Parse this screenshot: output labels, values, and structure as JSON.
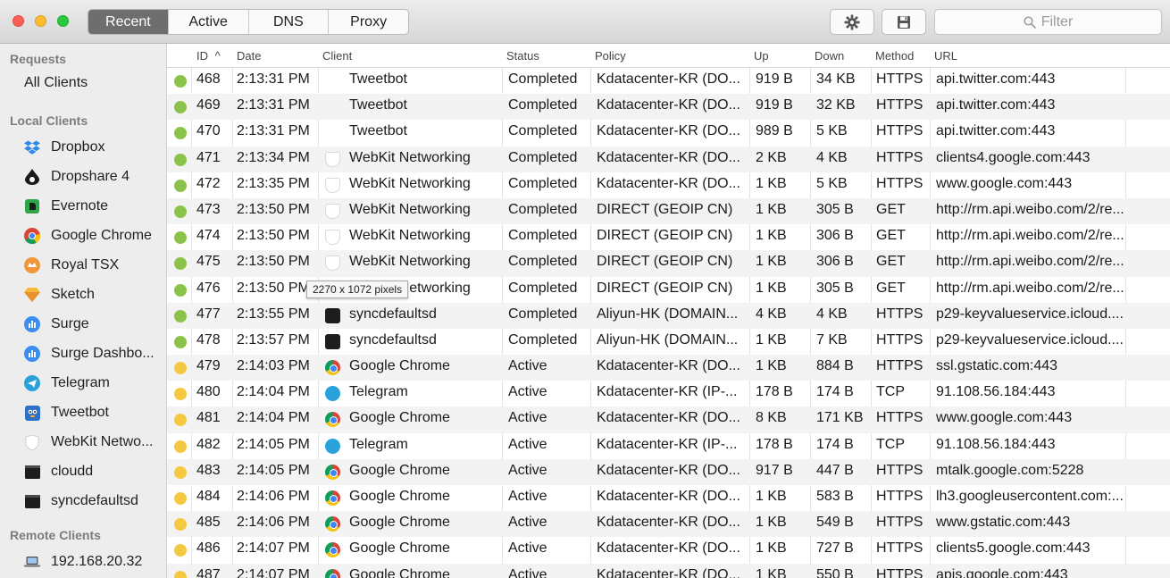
{
  "toolbar": {
    "tabs": [
      {
        "label": "Recent",
        "active": true
      },
      {
        "label": "Active",
        "active": false
      },
      {
        "label": "DNS",
        "active": false
      },
      {
        "label": "Proxy",
        "active": false
      }
    ],
    "filter_placeholder": "Filter",
    "settings_icon": "gear-icon",
    "save_icon": "floppy-disk-icon"
  },
  "sidebar": {
    "sections": {
      "requests": "Requests",
      "local": "Local Clients",
      "remote": "Remote Clients"
    },
    "all_clients": "All Clients",
    "local_clients": [
      {
        "label": "Dropbox",
        "icon": "dropbox-icon"
      },
      {
        "label": "Dropshare 4",
        "icon": "dropshare-icon"
      },
      {
        "label": "Evernote",
        "icon": "evernote-icon"
      },
      {
        "label": "Google Chrome",
        "icon": "chrome-icon"
      },
      {
        "label": "Royal TSX",
        "icon": "royal-tsx-icon"
      },
      {
        "label": "Sketch",
        "icon": "sketch-icon"
      },
      {
        "label": "Surge",
        "icon": "surge-icon"
      },
      {
        "label": "Surge Dashbo...",
        "icon": "surge-icon"
      },
      {
        "label": "Telegram",
        "icon": "telegram-icon"
      },
      {
        "label": "Tweetbot",
        "icon": "tweetbot-icon"
      },
      {
        "label": "WebKit Netwo...",
        "icon": "webkit-icon"
      },
      {
        "label": "cloudd",
        "icon": "terminal-icon"
      },
      {
        "label": "syncdefaultsd",
        "icon": "terminal-icon"
      }
    ],
    "remote_clients": [
      {
        "label": "192.168.20.32",
        "icon": "laptop-icon"
      }
    ]
  },
  "table": {
    "columns": {
      "id": "ID",
      "date": "Date",
      "client": "Client",
      "status": "Status",
      "policy": "Policy",
      "up": "Up",
      "down": "Down",
      "method": "Method",
      "url": "URL"
    },
    "sort_indicator": "^",
    "rows": [
      {
        "id": "468",
        "date": "2:13:31 PM",
        "client": "Tweetbot",
        "icon": "tweetbot",
        "status": "Completed",
        "policy": "Kdatacenter-KR (DO...",
        "up": "919 B",
        "down": "34 KB",
        "method": "HTTPS",
        "url": "api.twitter.com:443"
      },
      {
        "id": "469",
        "date": "2:13:31 PM",
        "client": "Tweetbot",
        "icon": "tweetbot",
        "status": "Completed",
        "policy": "Kdatacenter-KR (DO...",
        "up": "919 B",
        "down": "32 KB",
        "method": "HTTPS",
        "url": "api.twitter.com:443"
      },
      {
        "id": "470",
        "date": "2:13:31 PM",
        "client": "Tweetbot",
        "icon": "tweetbot",
        "status": "Completed",
        "policy": "Kdatacenter-KR (DO...",
        "up": "989 B",
        "down": "5 KB",
        "method": "HTTPS",
        "url": "api.twitter.com:443"
      },
      {
        "id": "471",
        "date": "2:13:34 PM",
        "client": "WebKit Networking",
        "icon": "webkit",
        "status": "Completed",
        "policy": "Kdatacenter-KR (DO...",
        "up": "2 KB",
        "down": "4 KB",
        "method": "HTTPS",
        "url": "clients4.google.com:443"
      },
      {
        "id": "472",
        "date": "2:13:35 PM",
        "client": "WebKit Networking",
        "icon": "webkit",
        "status": "Completed",
        "policy": "Kdatacenter-KR (DO...",
        "up": "1 KB",
        "down": "5 KB",
        "method": "HTTPS",
        "url": "www.google.com:443"
      },
      {
        "id": "473",
        "date": "2:13:50 PM",
        "client": "WebKit Networking",
        "icon": "webkit",
        "status": "Completed",
        "policy": "DIRECT (GEOIP CN)",
        "up": "1 KB",
        "down": "305 B",
        "method": "GET",
        "url": "http://rm.api.weibo.com/2/re..."
      },
      {
        "id": "474",
        "date": "2:13:50 PM",
        "client": "WebKit Networking",
        "icon": "webkit",
        "status": "Completed",
        "policy": "DIRECT (GEOIP CN)",
        "up": "1 KB",
        "down": "306 B",
        "method": "GET",
        "url": "http://rm.api.weibo.com/2/re..."
      },
      {
        "id": "475",
        "date": "2:13:50 PM",
        "client": "WebKit Networking",
        "icon": "webkit",
        "status": "Completed",
        "policy": "DIRECT (GEOIP CN)",
        "up": "1 KB",
        "down": "306 B",
        "method": "GET",
        "url": "http://rm.api.weibo.com/2/re..."
      },
      {
        "id": "476",
        "date": "2:13:50 PM",
        "client": "WebKit Networking",
        "icon": "webkit",
        "status": "Completed",
        "policy": "DIRECT (GEOIP CN)",
        "up": "1 KB",
        "down": "305 B",
        "method": "GET",
        "url": "http://rm.api.weibo.com/2/re..."
      },
      {
        "id": "477",
        "date": "2:13:55 PM",
        "client": "syncdefaultsd",
        "icon": "term",
        "status": "Completed",
        "policy": "Aliyun-HK (DOMAIN...",
        "up": "4 KB",
        "down": "4 KB",
        "method": "HTTPS",
        "url": "p29-keyvalueservice.icloud...."
      },
      {
        "id": "478",
        "date": "2:13:57 PM",
        "client": "syncdefaultsd",
        "icon": "term",
        "status": "Completed",
        "policy": "Aliyun-HK (DOMAIN...",
        "up": "1 KB",
        "down": "7 KB",
        "method": "HTTPS",
        "url": "p29-keyvalueservice.icloud...."
      },
      {
        "id": "479",
        "date": "2:14:03 PM",
        "client": "Google Chrome",
        "icon": "chrome",
        "status": "Active",
        "policy": "Kdatacenter-KR (DO...",
        "up": "1 KB",
        "down": "884 B",
        "method": "HTTPS",
        "url": "ssl.gstatic.com:443"
      },
      {
        "id": "480",
        "date": "2:14:04 PM",
        "client": "Telegram",
        "icon": "tg",
        "status": "Active",
        "policy": "Kdatacenter-KR (IP-...",
        "up": "178 B",
        "down": "174 B",
        "method": "TCP",
        "url": "91.108.56.184:443"
      },
      {
        "id": "481",
        "date": "2:14:04 PM",
        "client": "Google Chrome",
        "icon": "chrome",
        "status": "Active",
        "policy": "Kdatacenter-KR (DO...",
        "up": "8 KB",
        "down": "171 KB",
        "method": "HTTPS",
        "url": "www.google.com:443"
      },
      {
        "id": "482",
        "date": "2:14:05 PM",
        "client": "Telegram",
        "icon": "tg",
        "status": "Active",
        "policy": "Kdatacenter-KR (IP-...",
        "up": "178 B",
        "down": "174 B",
        "method": "TCP",
        "url": "91.108.56.184:443"
      },
      {
        "id": "483",
        "date": "2:14:05 PM",
        "client": "Google Chrome",
        "icon": "chrome",
        "status": "Active",
        "policy": "Kdatacenter-KR (DO...",
        "up": "917 B",
        "down": "447 B",
        "method": "HTTPS",
        "url": "mtalk.google.com:5228"
      },
      {
        "id": "484",
        "date": "2:14:06 PM",
        "client": "Google Chrome",
        "icon": "chrome",
        "status": "Active",
        "policy": "Kdatacenter-KR (DO...",
        "up": "1 KB",
        "down": "583 B",
        "method": "HTTPS",
        "url": "lh3.googleusercontent.com:..."
      },
      {
        "id": "485",
        "date": "2:14:06 PM",
        "client": "Google Chrome",
        "icon": "chrome",
        "status": "Active",
        "policy": "Kdatacenter-KR (DO...",
        "up": "1 KB",
        "down": "549 B",
        "method": "HTTPS",
        "url": "www.gstatic.com:443"
      },
      {
        "id": "486",
        "date": "2:14:07 PM",
        "client": "Google Chrome",
        "icon": "chrome",
        "status": "Active",
        "policy": "Kdatacenter-KR (DO...",
        "up": "1 KB",
        "down": "727 B",
        "method": "HTTPS",
        "url": "clients5.google.com:443"
      },
      {
        "id": "487",
        "date": "2:14:07 PM",
        "client": "Google Chrome",
        "icon": "chrome",
        "status": "Active",
        "policy": "Kdatacenter-KR (DO...",
        "up": "1 KB",
        "down": "550 B",
        "method": "HTTPS",
        "url": "apis.google.com:443"
      }
    ]
  },
  "tooltip": "2270 x 1072 pixels",
  "colors": {
    "completed": "#8bc34a",
    "active": "#f5c842",
    "selected_tab": "#6e6e6e"
  }
}
